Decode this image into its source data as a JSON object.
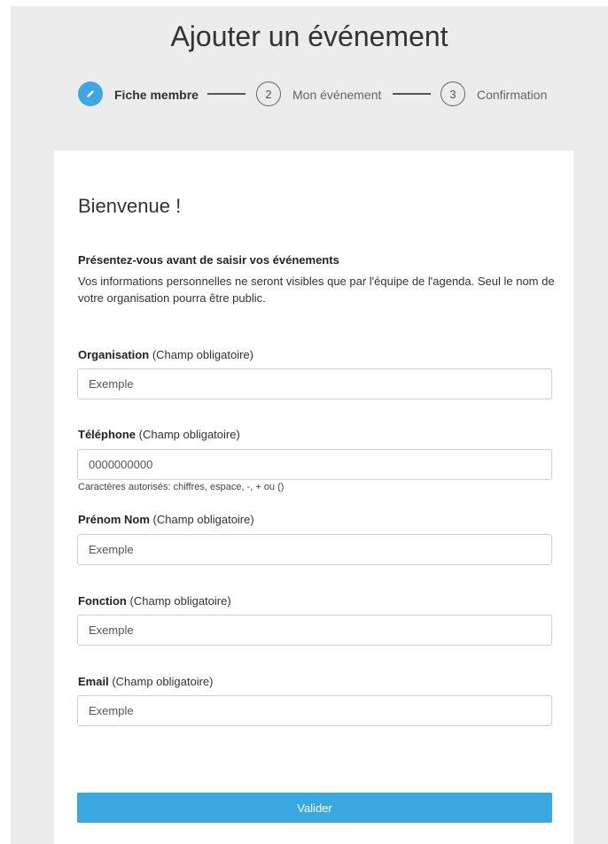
{
  "header": {
    "title": "Ajouter un événement"
  },
  "stepper": {
    "steps": [
      {
        "number": "",
        "label": "Fiche membre",
        "active": true
      },
      {
        "number": "2",
        "label": "Mon événement",
        "active": false
      },
      {
        "number": "3",
        "label": "Confirmation",
        "active": false
      }
    ]
  },
  "form": {
    "welcome": "Bienvenue !",
    "intro_title": "Présentez-vous avant de saisir vos événements",
    "intro_text": "Vos informations personnelles ne seront visibles que par l'équipe de l'agenda. Seul le nom de votre organisation pourra être public.",
    "fields": [
      {
        "label": "Organisation",
        "required": "(Champ obligatoire)",
        "placeholder": "Exemple"
      },
      {
        "label": "Téléphone",
        "required": "(Champ obligatoire)",
        "placeholder": "0000000000",
        "hint": "Caractères autorisés: chiffres, espace, -, + ou ()"
      },
      {
        "label": "Prénom Nom",
        "required": "(Champ obligatoire)",
        "placeholder": "Exemple"
      },
      {
        "label": "Fonction",
        "required": "(Champ obligatoire)",
        "placeholder": "Exemple"
      },
      {
        "label": "Email",
        "required": "(Champ obligatoire)",
        "placeholder": "Exemple"
      }
    ],
    "submit_label": "Valider"
  },
  "colors": {
    "accent": "#3aa8e0",
    "background": "#ececec"
  },
  "icons": {
    "step1": "pencil-icon"
  }
}
